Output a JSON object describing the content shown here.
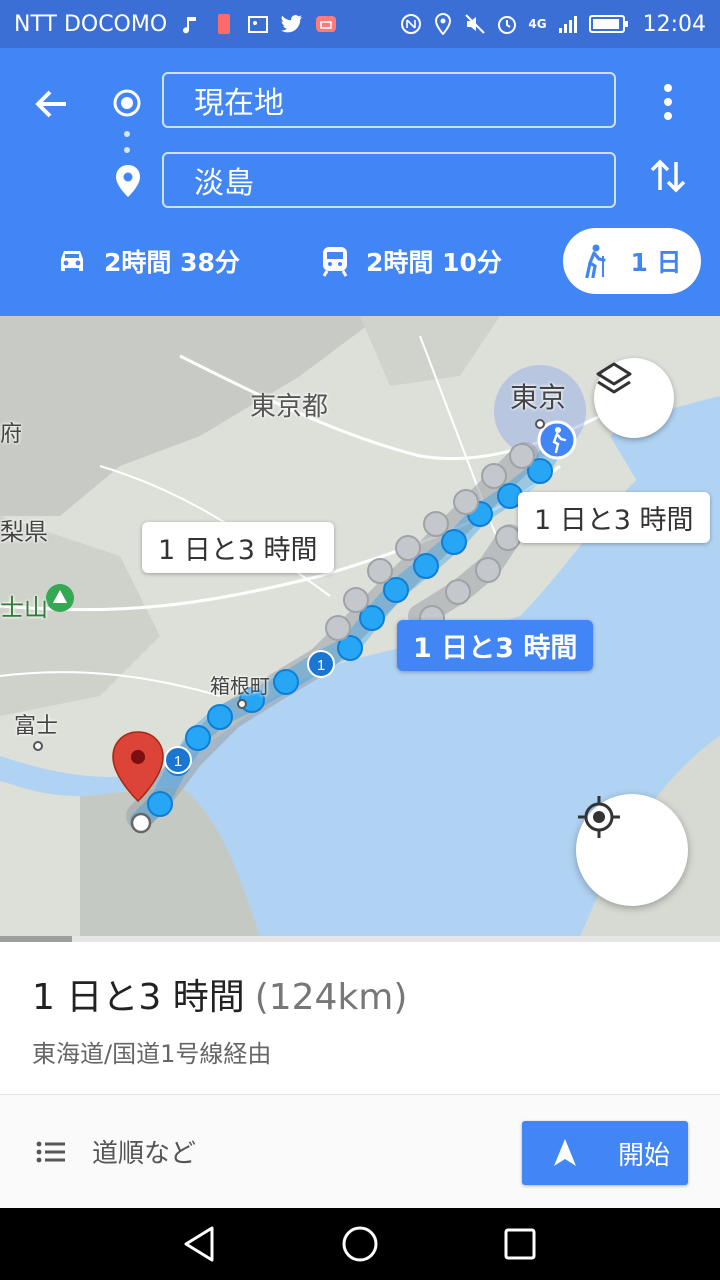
{
  "status_bar": {
    "carrier": "NTT DOCOMO",
    "network": "4G",
    "time": "12:04",
    "left_icons": [
      "music-icon",
      "phone-icon",
      "gallery-icon",
      "twitter-icon",
      "mail-icon"
    ],
    "right_icons": [
      "nfc-icon",
      "location-icon",
      "mute-icon",
      "alarm-icon",
      "signal-icon",
      "battery-icon"
    ]
  },
  "directions": {
    "origin": "現在地",
    "destination": "淡島"
  },
  "modes": {
    "car": "2時間 38分",
    "train": "2時間 10分",
    "walk": "1 日"
  },
  "map": {
    "place_labels": {
      "tokyo": "東京",
      "tokyo_to": "東京都",
      "hakone": "箱根町",
      "fuji": "富士",
      "ken": "梨県",
      "mountain": "士山",
      "edge": "府"
    },
    "route_labels": {
      "alt_left": "1 日と3 時間",
      "alt_right": "1 日と3 時間",
      "selected": "1 日と3 時間"
    },
    "route_badge": "1",
    "colors": {
      "water": "#b0d3f3",
      "route": "#1e9cf0",
      "alt_route": "#b5bcc4",
      "marker": "#db4437"
    }
  },
  "summary": {
    "duration": "1 日と3 時間",
    "distance": "(124km)",
    "via": "東海道/国道1号線経由"
  },
  "actions": {
    "steps": "道順など",
    "start": "開始"
  }
}
